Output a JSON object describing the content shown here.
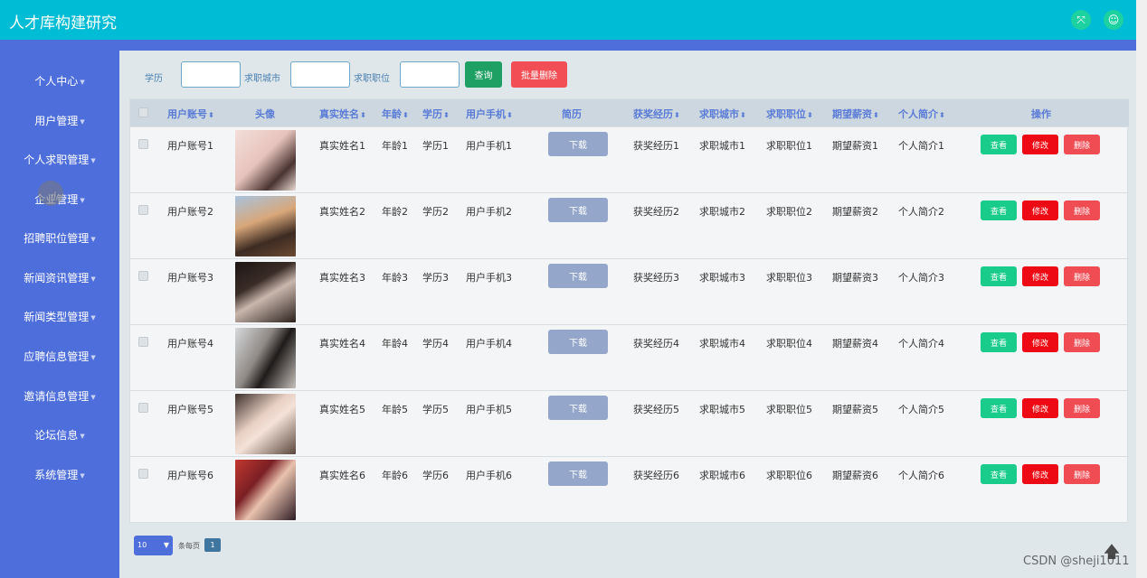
{
  "app": {
    "title": "人才库构建研究",
    "fullscreen_icon": "expand-icon",
    "user_icon": "user-icon"
  },
  "sidebar": {
    "items": [
      {
        "label": "个人中心"
      },
      {
        "label": "用户管理"
      },
      {
        "label": "个人求职管理"
      },
      {
        "label": "企业管理"
      },
      {
        "label": "招聘职位管理"
      },
      {
        "label": "新闻资讯管理"
      },
      {
        "label": "新闻类型管理"
      },
      {
        "label": "应聘信息管理"
      },
      {
        "label": "邀请信息管理"
      },
      {
        "label": "论坛信息"
      },
      {
        "label": "系统管理"
      }
    ]
  },
  "filters": {
    "education_label": "学历",
    "education_value": "",
    "city_label": "求职城市",
    "city_value": "",
    "position_label": "求职职位",
    "position_value": "",
    "query_button": "查询",
    "batch_delete_button": "批量删除"
  },
  "table": {
    "headers": {
      "account": "用户账号",
      "avatar": "头像",
      "real_name": "真实姓名",
      "age": "年龄",
      "education": "学历",
      "phone": "用户手机",
      "resume": "简历",
      "awards": "获奖经历",
      "city": "求职城市",
      "position": "求职职位",
      "salary": "期望薪资",
      "intro": "个人简介",
      "actions": "操作"
    },
    "download_label": "下载",
    "view_label": "查看",
    "edit_label": "修改",
    "delete_label": "删除",
    "rows": [
      {
        "account": "用户账号1",
        "real_name": "真实姓名1",
        "age": "年龄1",
        "education": "学历1",
        "phone": "用户手机1",
        "awards": "获奖经历1",
        "city": "求职城市1",
        "position": "求职职位1",
        "salary": "期望薪资1",
        "intro": "个人简介1"
      },
      {
        "account": "用户账号2",
        "real_name": "真实姓名2",
        "age": "年龄2",
        "education": "学历2",
        "phone": "用户手机2",
        "awards": "获奖经历2",
        "city": "求职城市2",
        "position": "求职职位2",
        "salary": "期望薪资2",
        "intro": "个人简介2"
      },
      {
        "account": "用户账号3",
        "real_name": "真实姓名3",
        "age": "年龄3",
        "education": "学历3",
        "phone": "用户手机3",
        "awards": "获奖经历3",
        "city": "求职城市3",
        "position": "求职职位3",
        "salary": "期望薪资3",
        "intro": "个人简介3"
      },
      {
        "account": "用户账号4",
        "real_name": "真实姓名4",
        "age": "年龄4",
        "education": "学历4",
        "phone": "用户手机4",
        "awards": "获奖经历4",
        "city": "求职城市4",
        "position": "求职职位4",
        "salary": "期望薪资4",
        "intro": "个人简介4"
      },
      {
        "account": "用户账号5",
        "real_name": "真实姓名5",
        "age": "年龄5",
        "education": "学历5",
        "phone": "用户手机5",
        "awards": "获奖经历5",
        "city": "求职城市5",
        "position": "求职职位5",
        "salary": "期望薪资5",
        "intro": "个人简介5"
      },
      {
        "account": "用户账号6",
        "real_name": "真实姓名6",
        "age": "年龄6",
        "education": "学历6",
        "phone": "用户手机6",
        "awards": "获奖经历6",
        "city": "求职城市6",
        "position": "求职职位6",
        "salary": "期望薪资6",
        "intro": "个人简介6"
      }
    ]
  },
  "pagination": {
    "page_size": "10",
    "per_page_label": "条每页",
    "current_page": "1"
  },
  "watermark": "CSDN @sheji1011",
  "colors": {
    "topbar": "#00bcd4",
    "sidebar": "#4e6edb",
    "query": "#1e9f63",
    "batch_delete": "#f14f55",
    "view": "#19cc8c",
    "edit": "#ee0a14",
    "delete": "#f04c53",
    "download": "#94a6c9"
  }
}
